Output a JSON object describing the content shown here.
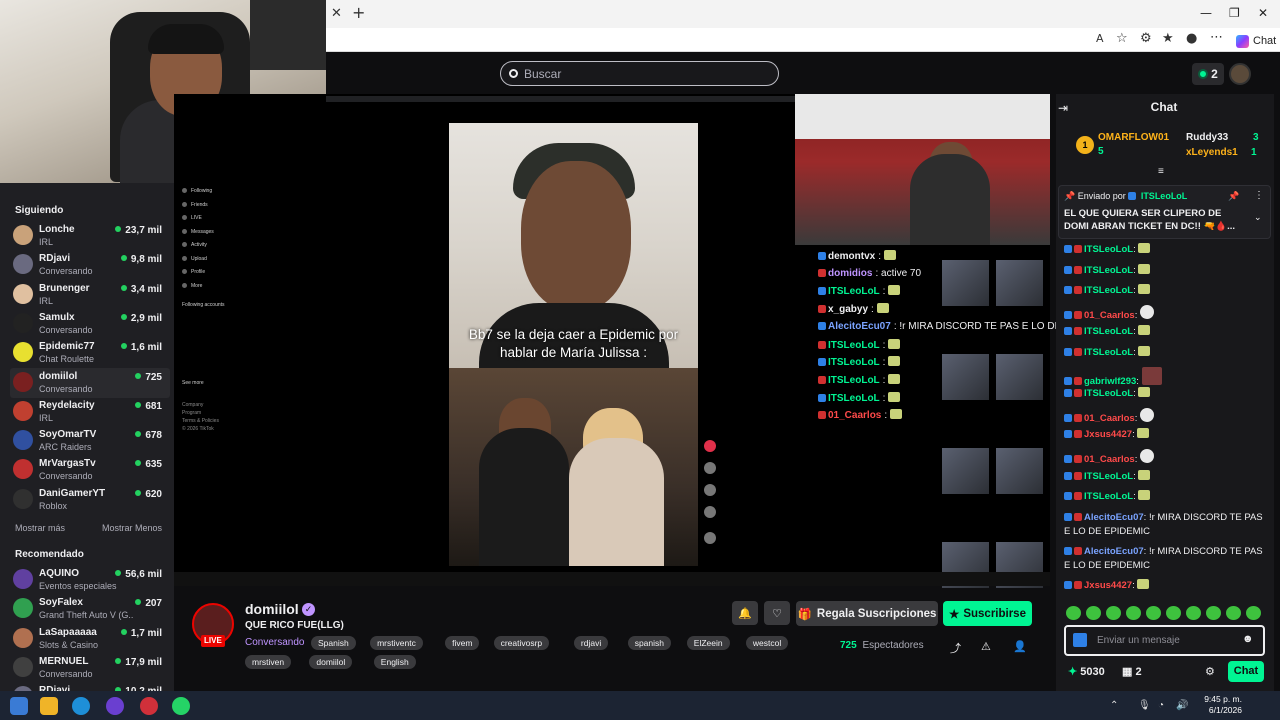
{
  "browser": {
    "new_tab": "+",
    "close_tab": "✕",
    "minimize": "—",
    "restore": "❐",
    "close": "✕",
    "copilot_label": "Chat"
  },
  "search": {
    "placeholder": "Buscar"
  },
  "topnav": {
    "notif_count": "2"
  },
  "sidebar": {
    "following_title": "Siguiendo",
    "following": [
      {
        "name": "Lonche",
        "sub": "IRL",
        "count": "23,7 mil",
        "color": "#c9a27a"
      },
      {
        "name": "RDjavi",
        "sub": "Conversando",
        "count": "9,8 mil",
        "color": "#6a6a80"
      },
      {
        "name": "Brunenger",
        "sub": "IRL",
        "count": "3,4 mil",
        "color": "#e0c0a0"
      },
      {
        "name": "Samulx",
        "sub": "Conversando",
        "count": "2,9 mil",
        "color": "#222"
      },
      {
        "name": "Epidemic77",
        "sub": "Chat Roulette",
        "count": "1,6 mil",
        "color": "#e8e030"
      },
      {
        "name": "domiilol",
        "sub": "Conversando",
        "count": "725",
        "color": "#7a2020"
      },
      {
        "name": "Reydelacity",
        "sub": "IRL",
        "count": "681",
        "color": "#c04030"
      },
      {
        "name": "SoyOmarTV",
        "sub": "ARC Raiders",
        "count": "678",
        "color": "#3050a0"
      },
      {
        "name": "MrVargasTv",
        "sub": "Conversando",
        "count": "635",
        "color": "#c03030"
      },
      {
        "name": "DaniGamerYT",
        "sub": "Roblox",
        "count": "620",
        "color": "#303030"
      }
    ],
    "show_more": "Mostrar más",
    "show_less": "Mostrar Menos",
    "recommended_title": "Recomendado",
    "recommended": [
      {
        "name": "AQUINO",
        "sub": "Eventos especiales",
        "count": "56,6 mil",
        "color": "#6040a0"
      },
      {
        "name": "SoyFalex",
        "sub": "Grand Theft Auto V (G...",
        "count": "207",
        "color": "#30a050"
      },
      {
        "name": "LaSapaaaaa",
        "sub": "Slots & Casino",
        "count": "1,7 mil",
        "color": "#b07050"
      },
      {
        "name": "MERNUEL",
        "sub": "Conversando",
        "count": "17,9 mil",
        "color": "#404040"
      },
      {
        "name": "RDjavi",
        "sub": "",
        "count": "10,2 mil",
        "color": "#6a6a80"
      }
    ]
  },
  "video": {
    "inner_nav": [
      "Following",
      "Friends",
      "LIVE",
      "Messages",
      "Activity",
      "Upload",
      "Profile",
      "More"
    ],
    "inner_nav_sub": "Following accounts",
    "inner_see_more": "See more",
    "inner_footer": [
      "Company",
      "Program",
      "Terms & Policies",
      "© 2026 TikTok"
    ],
    "caption": "Bb7 se la deja caer a Epidemic por hablar de María Julissa :",
    "overlay_chat": [
      {
        "user": "demontvx",
        "msg": "",
        "color": "#efeff1"
      },
      {
        "user": "domidios",
        "msg": "active 70",
        "color": "#bf94ff"
      },
      {
        "user": "ITSLeoLoL",
        "msg": "",
        "color": "#00f593"
      },
      {
        "user": "x_gabyy",
        "msg": "",
        "color": "#efeff1"
      },
      {
        "user": "AlecitoEcu07",
        "msg": "!r MIRA DISCORD TE PAS E LO DE EPI",
        "color": "#7aa3ff"
      },
      {
        "user": "ITSLeoLoL",
        "msg": "",
        "color": "#00f593"
      },
      {
        "user": "ITSLeoLoL",
        "msg": "",
        "color": "#00f593"
      },
      {
        "user": "ITSLeoLoL",
        "msg": "",
        "color": "#00f593"
      },
      {
        "user": "ITSLeoLoL",
        "msg": "",
        "color": "#00f593"
      },
      {
        "user": "01_Caarlos",
        "msg": "",
        "color": "#ff4a4a"
      }
    ]
  },
  "stream": {
    "channel": "domiilol",
    "live": "LIVE",
    "title": "QUE RICO FUE(LLG)",
    "category": "Conversando",
    "tags_row1": [
      "Spanish",
      "mrstiventc",
      "fivem",
      "creativosrp",
      "rdjavi",
      "spanish",
      "ElZeein",
      "westcol"
    ],
    "tags_row2": [
      "mrstiven",
      "domiilol",
      "English"
    ],
    "gift_label": "Regala Suscripciones",
    "sub_label": "Suscribirse",
    "viewers_count": "725",
    "viewers_label": "Espectadores"
  },
  "chat": {
    "title": "Chat",
    "leaderboard": [
      {
        "rank": "1",
        "name": "OMARFLOW01",
        "n": "5"
      },
      {
        "name": "Ruddy33",
        "n": "3"
      },
      {
        "name": "xLeyends1",
        "n": "1"
      }
    ],
    "pinned_by_label": "Enviado por",
    "pinned_by_user": "ITSLeoLoL",
    "pinned_text": "EL QUE QUIERA SER CLIPERO DE DOMI ABRAN TICKET EN DC!! 🔫🩸...",
    "messages": [
      {
        "user": "ITSLeoLoL",
        "msg": "",
        "color": "#00f593"
      },
      {
        "user": "ITSLeoLoL",
        "msg": "",
        "color": "#00f593"
      },
      {
        "user": "ITSLeoLoL",
        "msg": "",
        "color": "#00f593"
      },
      {
        "user": "01_Caarlos",
        "msg": "",
        "color": "#ff4a4a"
      },
      {
        "user": "ITSLeoLoL",
        "msg": "",
        "color": "#00f593"
      },
      {
        "user": "ITSLeoLoL",
        "msg": "",
        "color": "#00f593"
      },
      {
        "user": "gabriwlf293",
        "msg": "",
        "color": "#00f593"
      },
      {
        "user": "ITSLeoLoL",
        "msg": "",
        "color": "#00f593"
      },
      {
        "user": "01_Caarlos",
        "msg": "",
        "color": "#ff4a4a"
      },
      {
        "user": "Jxsus4427",
        "msg": "",
        "color": "#ff4a4a"
      },
      {
        "user": "01_Caarlos",
        "msg": "",
        "color": "#ff4a4a"
      },
      {
        "user": "ITSLeoLoL",
        "msg": "",
        "color": "#00f593"
      },
      {
        "user": "ITSLeoLoL",
        "msg": "",
        "color": "#00f593"
      },
      {
        "user": "AlecitoEcu07",
        "msg": "!r MIRA DISCORD TE PAS E LO DE EPIDEMIC",
        "color": "#7aa3ff"
      },
      {
        "user": "AlecitoEcu07",
        "msg": "!r MIRA DISCORD TE PAS E LO DE EPIDEMIC",
        "color": "#7aa3ff"
      },
      {
        "user": "Jxsus4427",
        "msg": "",
        "color": "#ff4a4a"
      }
    ],
    "input_placeholder": "Enviar un mensaje",
    "points": "5030",
    "drops": "2",
    "send_label": "Chat"
  },
  "taskbar": {
    "time": "9:45 p. m.",
    "date": "6/1/2026"
  }
}
